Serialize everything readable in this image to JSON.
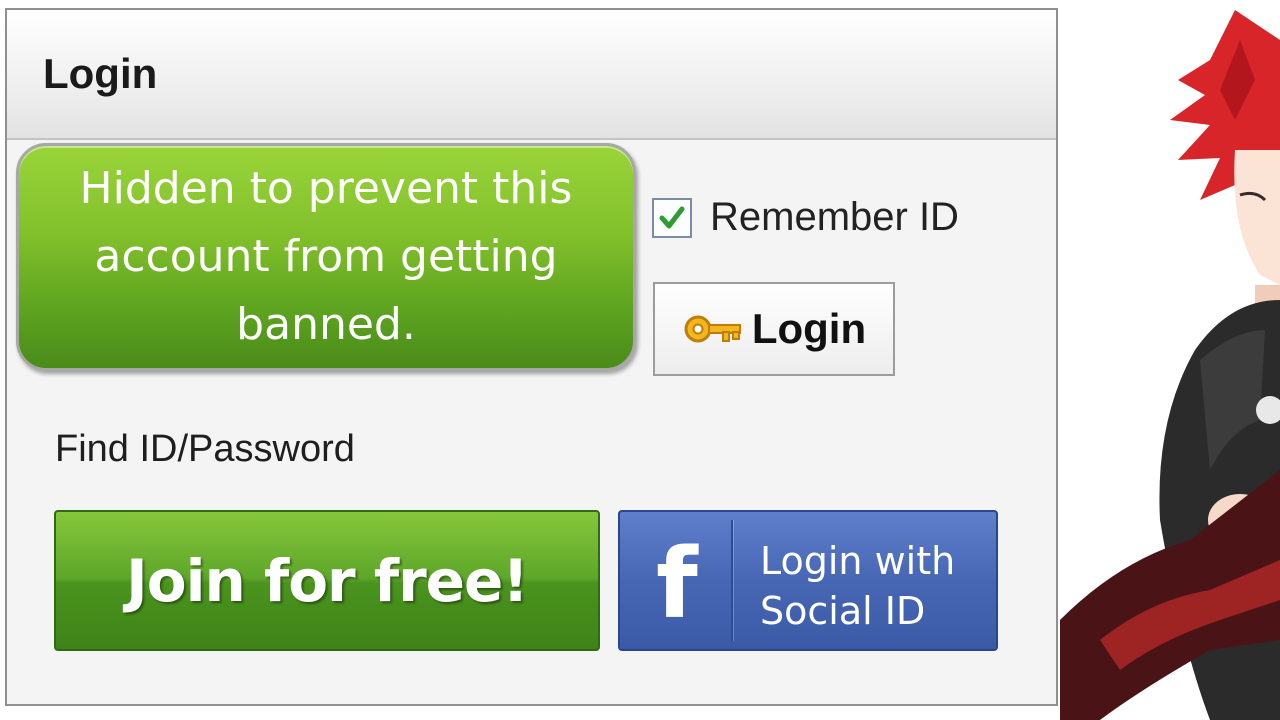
{
  "panel": {
    "title": "Login"
  },
  "notice": {
    "text": "Hidden to prevent this account from getting banned."
  },
  "remember": {
    "label": "Remember ID",
    "checked": true
  },
  "login_button": {
    "label": "Login",
    "icon": "key-icon"
  },
  "find_link": {
    "label": "Find ID/Password"
  },
  "join_button": {
    "label": "Join for free!"
  },
  "social_button": {
    "icon_glyph": "f",
    "label_line1": "Login with",
    "label_line2": "Social ID"
  },
  "colors": {
    "join_green": "#5ea729",
    "facebook_blue": "#4767b5",
    "notice_green": "#82c02b",
    "check_green": "#2e9c2e"
  }
}
